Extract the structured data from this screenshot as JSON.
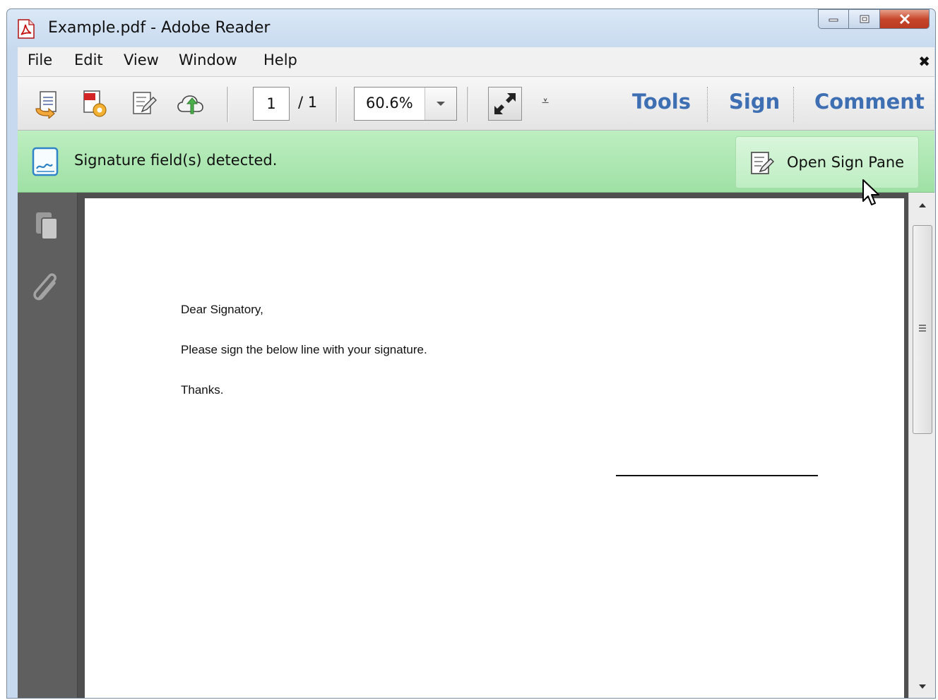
{
  "window": {
    "title": "Example.pdf - Adobe Reader",
    "app_icon": "pdf-file-icon",
    "caption_buttons": [
      "minimize-icon",
      "maximize-icon",
      "close-icon"
    ]
  },
  "menubar": {
    "items": [
      {
        "label": "File"
      },
      {
        "label": "Edit"
      },
      {
        "label": "View"
      },
      {
        "label": "Window"
      },
      {
        "label": "Help"
      }
    ],
    "close_glyph": "✖"
  },
  "toolbar": {
    "icons": [
      "open-file-icon",
      "create-pdf-icon",
      "edit-document-icon",
      "cloud-upload-icon"
    ],
    "page_current": "1",
    "page_total": "/ 1",
    "zoom_value": "60.6%",
    "fit_icon": "fit-page-arrows-icon",
    "more_glyph": "⩡",
    "links": {
      "tools": "Tools",
      "sign": "Sign",
      "comment": "Comment"
    }
  },
  "signature_bar": {
    "message": "Signature field(s) detected.",
    "button_label": "Open Sign Pane",
    "accent": "#a7e4ab"
  },
  "left_rail": {
    "icons": [
      "pages-icon",
      "attachments-icon"
    ]
  },
  "document": {
    "lines": [
      "Dear Signatory,",
      "Please sign the below line with your signature.",
      "Thanks."
    ]
  },
  "colors": {
    "link_blue": "#3f6fb3",
    "rail_gray": "#5f5f5f",
    "signature_green": "#bdeec0"
  }
}
